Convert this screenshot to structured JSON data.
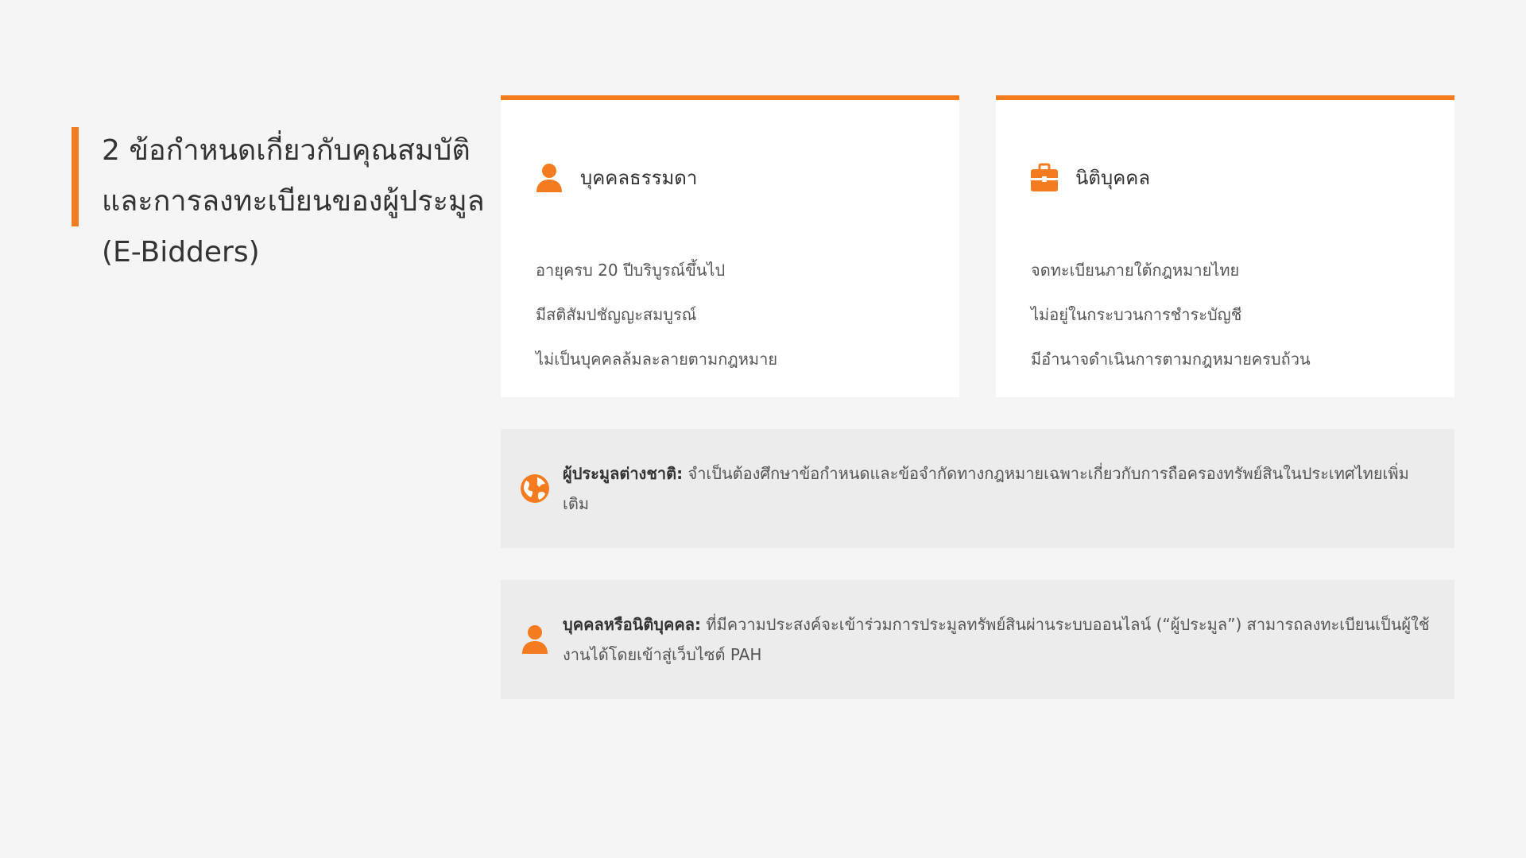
{
  "title": {
    "line1": "2 ข้อกำหนดเกี่ยวกับคุณสมบัติ",
    "line2": "และการลงทะเบียนของผู้ประมูล",
    "line3": "(E-Bidders)"
  },
  "cards": [
    {
      "icon": "person-icon",
      "title": "บุคคลธรรมดา",
      "items": [
        "อายุครบ 20 ปีบริบูรณ์ขึ้นไป",
        "มีสติสัมปชัญญะสมบูรณ์",
        "ไม่เป็นบุคคลล้มละลายตามกฎหมาย"
      ]
    },
    {
      "icon": "briefcase-icon",
      "title": "นิติบุคคล",
      "items": [
        "จดทะเบียนภายใต้กฎหมายไทย",
        "ไม่อยู่ในกระบวนการชำระบัญชี",
        "มีอำนาจดำเนินการตามกฎหมายครบถ้วน"
      ]
    }
  ],
  "notices": [
    {
      "icon": "globe-icon",
      "label": "ผู้ประมูลต่างชาติ:",
      "text": " จำเป็นต้องศึกษาข้อกำหนดและข้อจำกัดทางกฎหมายเฉพาะเกี่ยวกับการถือครองทรัพย์สินในประเทศไทยเพิ่มเติม"
    },
    {
      "icon": "person-icon",
      "label": "บุคคลหรือนิติบุคคล:",
      "text": " ที่มีความประสงค์จะเข้าร่วมการประมูลทรัพย์สินผ่านระบบออนไลน์ (“ผู้ประมูล”) สามารถลงทะเบียนเป็นผู้ใช้งานได้โดยเข้าสู่เว็บไซต์ PAH"
    }
  ],
  "colors": {
    "accent": "#f47b20",
    "background": "#f5f5f5",
    "card": "#ffffff",
    "notice": "#ececec"
  }
}
